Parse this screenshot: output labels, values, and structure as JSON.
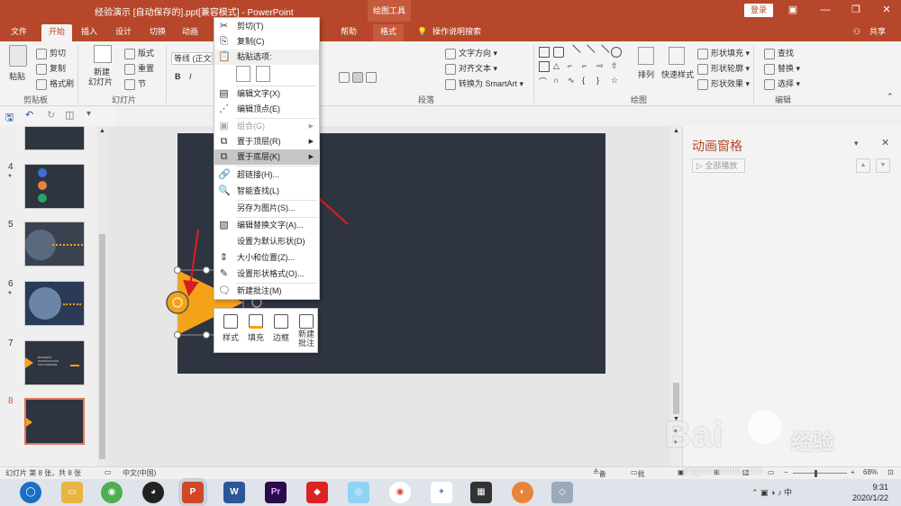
{
  "titlebar": {
    "title": "经验演示 [自动保存的].ppt[兼容模式]  -  PowerPoint",
    "tools_label": "绘图工具",
    "login": "登录",
    "min_icon": "minimize-icon",
    "restore_icon": "restore-icon",
    "max_icon": "maximize-icon",
    "close_icon": "close-icon"
  },
  "tabs": [
    {
      "label": "文件"
    },
    {
      "label": "开始"
    },
    {
      "label": "插入"
    },
    {
      "label": "设计"
    },
    {
      "label": "切换"
    },
    {
      "label": "动画"
    },
    {
      "label": "帮助"
    },
    {
      "label": "格式"
    },
    {
      "label": "操作说明搜索"
    },
    {
      "label": "共享"
    }
  ],
  "ribbon": {
    "paste": "粘贴",
    "cut": "剪切",
    "copy": "复制",
    "format_painter": "格式刷",
    "clipboard_group": "剪贴板",
    "new_slide": "新建\n幻灯片",
    "new_slide_line1": "新建",
    "new_slide_line2": "幻灯片",
    "layout": "版式",
    "reset": "重置",
    "section": "节",
    "slides_group": "幻灯片",
    "font_name": "等线 (正文)",
    "bold": "B",
    "italic": "I",
    "text_direction": "文字方向",
    "align_text": "对齐文本",
    "convert_smartart": "转换为 SmartArt",
    "paragraph_group": "段落",
    "arrange": "排列",
    "quick_styles": "快速样式",
    "shape_fill": "形状填充",
    "shape_outline": "形状轮廓",
    "shape_effects": "形状效果",
    "drawing_group": "绘图",
    "find": "查找",
    "replace": "替换",
    "select": "选择",
    "editing_group": "编辑"
  },
  "thumbnails": [
    {
      "num": "4",
      "star": "*"
    },
    {
      "num": "5",
      "star": ""
    },
    {
      "num": "6",
      "star": "*"
    },
    {
      "num": "7",
      "star": ""
    },
    {
      "num": "8",
      "star": ""
    }
  ],
  "thumb7_text": "BUSINESS INTRODUCTION WITH DREAMS",
  "context_menu": {
    "items": [
      {
        "label": "剪切(T)",
        "icon": "scissors-icon"
      },
      {
        "label": "复制(C)",
        "icon": "copy-icon"
      },
      {
        "label": "粘贴选项:",
        "icon": "paste-icon"
      },
      {
        "label": "编辑文字(X)",
        "icon": "edit-text-icon"
      },
      {
        "label": "编辑顶点(E)",
        "icon": "edit-points-icon"
      },
      {
        "label": "组合(G)",
        "icon": "group-icon"
      },
      {
        "label": "置于顶层(R)",
        "icon": "bring-front-icon"
      },
      {
        "label": "置于底层(K)",
        "icon": "send-back-icon"
      },
      {
        "label": "超链接(H)...",
        "icon": "link-icon"
      },
      {
        "label": "智能查找(L)",
        "icon": "smart-lookup-icon"
      },
      {
        "label": "另存为图片(S)...",
        "icon": ""
      },
      {
        "label": "编辑替换文字(A)...",
        "icon": "alt-text-icon"
      },
      {
        "label": "设置为默认形状(D)",
        "icon": ""
      },
      {
        "label": "大小和位置(Z)...",
        "icon": "size-position-icon"
      },
      {
        "label": "设置形状格式(O)...",
        "icon": "format-shape-icon"
      },
      {
        "label": "新建批注(M)",
        "icon": "new-comment-icon"
      }
    ]
  },
  "mini_toolbar": {
    "style": "样式",
    "fill": "填充",
    "border": "边框",
    "new_comment_line1": "新建",
    "new_comment_line2": "批注"
  },
  "anim_pane": {
    "title": "动画窗格",
    "play_all": "全部播放"
  },
  "status": {
    "slide_info": "幻灯片 第 8 张，共 8 张",
    "language": "中文(中国)",
    "notes": "备注",
    "comments": "批注",
    "zoom": "68%"
  },
  "taskbar": {
    "time": "9:31",
    "date": "2020/1/22"
  },
  "watermark": {
    "text": "Bai",
    "text2": "经验",
    "url": "jingyan.baidu.com"
  },
  "colors": {
    "accent": "#b7472a",
    "slide_bg": "#2e3440",
    "shape_orange": "#f5a21a",
    "arrow_red": "#d21f1f"
  }
}
